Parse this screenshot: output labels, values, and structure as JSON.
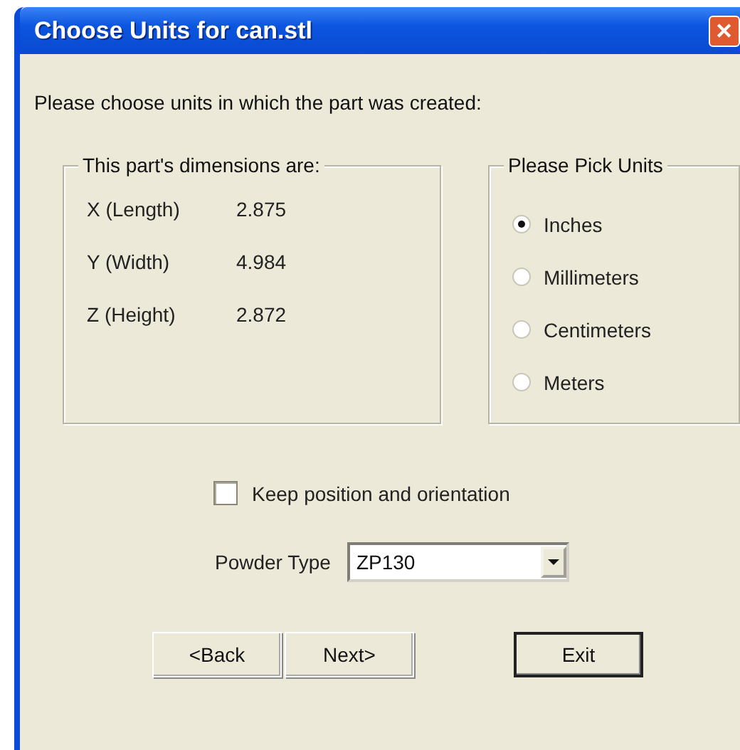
{
  "window": {
    "title": "Choose Units for can.stl",
    "close": "✕"
  },
  "prompt": "Please choose units in which the part was created:",
  "dimensions": {
    "title": "This part's dimensions are:",
    "rows": [
      {
        "label": "X (Length)",
        "value": "2.875"
      },
      {
        "label": "Y (Width)",
        "value": "4.984"
      },
      {
        "label": "Z (Height)",
        "value": "2.872"
      }
    ]
  },
  "units": {
    "title": "Please Pick Units",
    "options": [
      {
        "label": "Inches",
        "selected": true
      },
      {
        "label": "Millimeters",
        "selected": false
      },
      {
        "label": "Centimeters",
        "selected": false
      },
      {
        "label": "Meters",
        "selected": false
      }
    ]
  },
  "keep_position": {
    "label": "Keep position and orientation",
    "checked": false
  },
  "powder_type": {
    "label": "Powder Type",
    "value": "ZP130"
  },
  "buttons": [
    {
      "label": "<Back",
      "kind": "nav"
    },
    {
      "label": "Next>",
      "kind": "nav"
    },
    {
      "label": "Exit",
      "kind": "default"
    }
  ]
}
